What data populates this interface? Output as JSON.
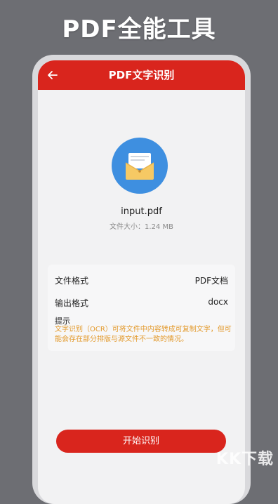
{
  "promo": {
    "title": "PDF全能工具"
  },
  "header": {
    "title": "PDF文字识别",
    "back_icon": "arrow-left-icon"
  },
  "file": {
    "icon": "folder-document-icon",
    "name": "input.pdf",
    "size_label": "文件大小：1.24 MB"
  },
  "info": {
    "rows": [
      {
        "label": "文件格式",
        "value": "PDF文档"
      },
      {
        "label": "输出格式",
        "value": "docx"
      }
    ],
    "tip_title": "提示",
    "tip_text": "文字识别（OCR）可将文件中内容转成可复制文字，但可能会存在部分排版与源文件不一致的情况。"
  },
  "actions": {
    "start_label": "开始识别"
  },
  "watermark": {
    "text": "KK下载"
  },
  "colors": {
    "accent": "#d9251d",
    "icon_bg": "#3e8fe0",
    "tip": "#e39a2c",
    "background": "#6d6e73"
  }
}
